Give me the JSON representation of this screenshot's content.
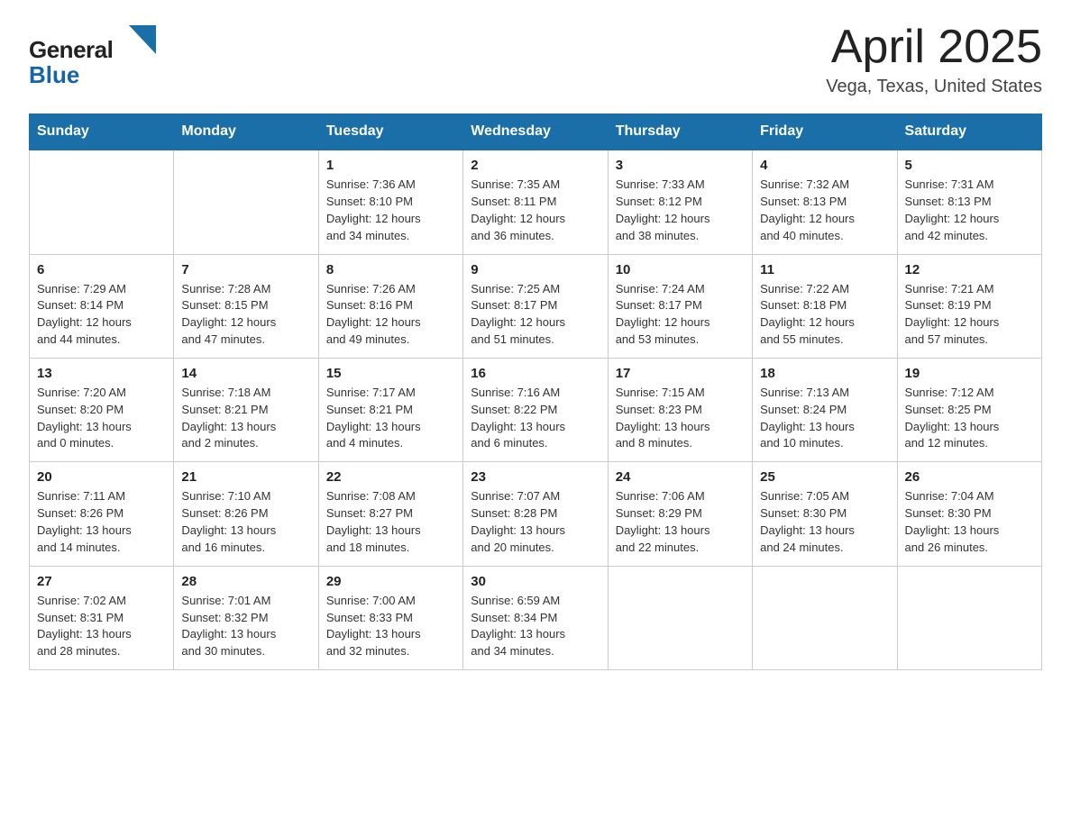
{
  "header": {
    "logo_general": "General",
    "logo_blue": "Blue",
    "title": "April 2025",
    "subtitle": "Vega, Texas, United States"
  },
  "weekdays": [
    "Sunday",
    "Monday",
    "Tuesday",
    "Wednesday",
    "Thursday",
    "Friday",
    "Saturday"
  ],
  "weeks": [
    [
      {
        "day": "",
        "info": ""
      },
      {
        "day": "",
        "info": ""
      },
      {
        "day": "1",
        "info": "Sunrise: 7:36 AM\nSunset: 8:10 PM\nDaylight: 12 hours\nand 34 minutes."
      },
      {
        "day": "2",
        "info": "Sunrise: 7:35 AM\nSunset: 8:11 PM\nDaylight: 12 hours\nand 36 minutes."
      },
      {
        "day": "3",
        "info": "Sunrise: 7:33 AM\nSunset: 8:12 PM\nDaylight: 12 hours\nand 38 minutes."
      },
      {
        "day": "4",
        "info": "Sunrise: 7:32 AM\nSunset: 8:13 PM\nDaylight: 12 hours\nand 40 minutes."
      },
      {
        "day": "5",
        "info": "Sunrise: 7:31 AM\nSunset: 8:13 PM\nDaylight: 12 hours\nand 42 minutes."
      }
    ],
    [
      {
        "day": "6",
        "info": "Sunrise: 7:29 AM\nSunset: 8:14 PM\nDaylight: 12 hours\nand 44 minutes."
      },
      {
        "day": "7",
        "info": "Sunrise: 7:28 AM\nSunset: 8:15 PM\nDaylight: 12 hours\nand 47 minutes."
      },
      {
        "day": "8",
        "info": "Sunrise: 7:26 AM\nSunset: 8:16 PM\nDaylight: 12 hours\nand 49 minutes."
      },
      {
        "day": "9",
        "info": "Sunrise: 7:25 AM\nSunset: 8:17 PM\nDaylight: 12 hours\nand 51 minutes."
      },
      {
        "day": "10",
        "info": "Sunrise: 7:24 AM\nSunset: 8:17 PM\nDaylight: 12 hours\nand 53 minutes."
      },
      {
        "day": "11",
        "info": "Sunrise: 7:22 AM\nSunset: 8:18 PM\nDaylight: 12 hours\nand 55 minutes."
      },
      {
        "day": "12",
        "info": "Sunrise: 7:21 AM\nSunset: 8:19 PM\nDaylight: 12 hours\nand 57 minutes."
      }
    ],
    [
      {
        "day": "13",
        "info": "Sunrise: 7:20 AM\nSunset: 8:20 PM\nDaylight: 13 hours\nand 0 minutes."
      },
      {
        "day": "14",
        "info": "Sunrise: 7:18 AM\nSunset: 8:21 PM\nDaylight: 13 hours\nand 2 minutes."
      },
      {
        "day": "15",
        "info": "Sunrise: 7:17 AM\nSunset: 8:21 PM\nDaylight: 13 hours\nand 4 minutes."
      },
      {
        "day": "16",
        "info": "Sunrise: 7:16 AM\nSunset: 8:22 PM\nDaylight: 13 hours\nand 6 minutes."
      },
      {
        "day": "17",
        "info": "Sunrise: 7:15 AM\nSunset: 8:23 PM\nDaylight: 13 hours\nand 8 minutes."
      },
      {
        "day": "18",
        "info": "Sunrise: 7:13 AM\nSunset: 8:24 PM\nDaylight: 13 hours\nand 10 minutes."
      },
      {
        "day": "19",
        "info": "Sunrise: 7:12 AM\nSunset: 8:25 PM\nDaylight: 13 hours\nand 12 minutes."
      }
    ],
    [
      {
        "day": "20",
        "info": "Sunrise: 7:11 AM\nSunset: 8:26 PM\nDaylight: 13 hours\nand 14 minutes."
      },
      {
        "day": "21",
        "info": "Sunrise: 7:10 AM\nSunset: 8:26 PM\nDaylight: 13 hours\nand 16 minutes."
      },
      {
        "day": "22",
        "info": "Sunrise: 7:08 AM\nSunset: 8:27 PM\nDaylight: 13 hours\nand 18 minutes."
      },
      {
        "day": "23",
        "info": "Sunrise: 7:07 AM\nSunset: 8:28 PM\nDaylight: 13 hours\nand 20 minutes."
      },
      {
        "day": "24",
        "info": "Sunrise: 7:06 AM\nSunset: 8:29 PM\nDaylight: 13 hours\nand 22 minutes."
      },
      {
        "day": "25",
        "info": "Sunrise: 7:05 AM\nSunset: 8:30 PM\nDaylight: 13 hours\nand 24 minutes."
      },
      {
        "day": "26",
        "info": "Sunrise: 7:04 AM\nSunset: 8:30 PM\nDaylight: 13 hours\nand 26 minutes."
      }
    ],
    [
      {
        "day": "27",
        "info": "Sunrise: 7:02 AM\nSunset: 8:31 PM\nDaylight: 13 hours\nand 28 minutes."
      },
      {
        "day": "28",
        "info": "Sunrise: 7:01 AM\nSunset: 8:32 PM\nDaylight: 13 hours\nand 30 minutes."
      },
      {
        "day": "29",
        "info": "Sunrise: 7:00 AM\nSunset: 8:33 PM\nDaylight: 13 hours\nand 32 minutes."
      },
      {
        "day": "30",
        "info": "Sunrise: 6:59 AM\nSunset: 8:34 PM\nDaylight: 13 hours\nand 34 minutes."
      },
      {
        "day": "",
        "info": ""
      },
      {
        "day": "",
        "info": ""
      },
      {
        "day": "",
        "info": ""
      }
    ]
  ]
}
